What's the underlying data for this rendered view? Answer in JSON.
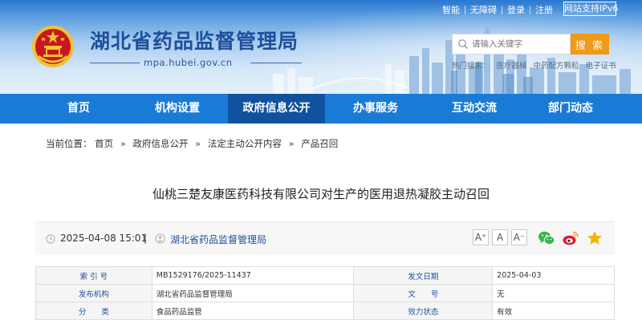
{
  "header": {
    "site_title": "湖北省药品监督管理局",
    "site_url": "mpa.hubei.gov.cn",
    "top_links": [
      "智能",
      "无障碍",
      "登录",
      "注册"
    ],
    "ipv6_label": "网站支持IPv6",
    "search": {
      "placeholder": "请输入关键字",
      "button_label": "搜 索"
    },
    "hot_search_label": "热门搜索：",
    "hot_search_terms": [
      "医疗器械",
      "中药配方颗粒",
      "电子证书"
    ]
  },
  "nav": {
    "items": [
      "首页",
      "机构设置",
      "政府信息公开",
      "办事服务",
      "互动交流",
      "部门动态"
    ],
    "active_index": 2
  },
  "breadcrumb": {
    "label": "当前位置：",
    "items": [
      "首页",
      "政府信息公开",
      "法定主动公开内容",
      "产品召回"
    ],
    "separator": "»"
  },
  "article": {
    "title": "仙桃三楚友康医药科技有限公司对生产的医用退热凝胶主动召回",
    "date": "2025-04-08 15:01",
    "divider": "|",
    "source": "湖北省药品监督管理局",
    "font_sizes": [
      "A⁺",
      "A",
      "A⁻"
    ],
    "share_icons": [
      "wechat-icon",
      "weibo-icon",
      "favorite-star-icon"
    ]
  },
  "info_table": {
    "rows": [
      {
        "label1": "索 引 号",
        "value1": "MB1529176/2025-11437",
        "label2": "发文日期",
        "value2": "2025-04-03"
      },
      {
        "label1": "发布机构",
        "value1": "湖北省药品监督管理局",
        "label2": "文　　号",
        "value2": "无"
      },
      {
        "label1": "分　　类",
        "value1": "食品药品监管",
        "label2": "效力状态",
        "value2": "有效"
      }
    ]
  },
  "colors": {
    "nav_bg": "#1a7bd6",
    "nav_active_bg": "#10529f",
    "title_blue": "#1f4f9c",
    "search_button": "#f09a17",
    "emblem_red": "#c8161d",
    "emblem_gold": "#f2c232"
  }
}
